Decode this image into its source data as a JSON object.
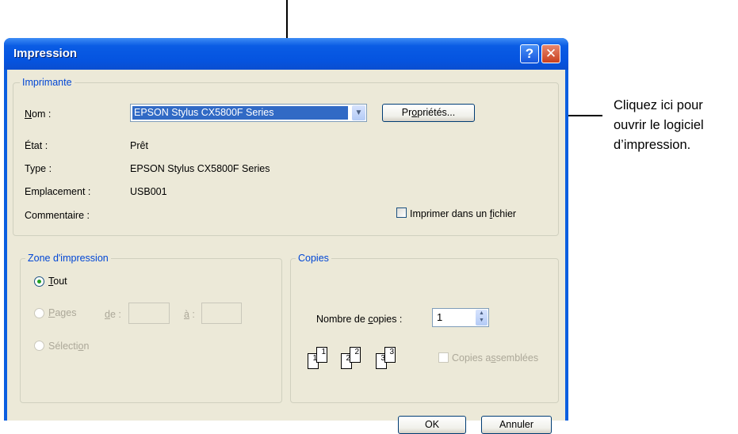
{
  "callout": {
    "line1": "Cliquez ici pour",
    "line2": "ouvrir le logiciel",
    "line3": "d’impression."
  },
  "dialog": {
    "title": "Impression",
    "help_glyph": "?",
    "close_glyph": "✕"
  },
  "printer": {
    "legend": "Imprimante",
    "name_label_u": "N",
    "name_label_rest": "om :",
    "name_value": "EPSON Stylus CX5800F Series",
    "properties_prefix": "Pr",
    "properties_u": "o",
    "properties_rest": "priétés...",
    "state_label": "État :",
    "state_value": "Prêt",
    "type_label": "Type :",
    "type_value": "EPSON Stylus CX5800F Series",
    "location_label": "Emplacement :",
    "location_value": "USB001",
    "comment_label": "Commentaire :",
    "print_to_file_prefix": "Imprimer dans un ",
    "print_to_file_u": "f",
    "print_to_file_rest": "ichier"
  },
  "range": {
    "legend": "Zone d'impression",
    "all_u": "T",
    "all_rest": "out",
    "pages_u": "P",
    "pages_rest": "ages",
    "from_u": "d",
    "from_rest": "e :",
    "to_u": "à",
    "to_rest": " :",
    "selection_prefix": "Sélecti",
    "selection_u": "o",
    "selection_rest": "n"
  },
  "copies": {
    "legend": "Copies",
    "count_label_prefix": "Nombre de ",
    "count_label_u": "c",
    "count_label_rest": "opies :",
    "count_value": "1",
    "collate_prefix": "Copies a",
    "collate_u": "s",
    "collate_rest": "semblées",
    "page_numbers": [
      "1",
      "1",
      "2",
      "2",
      "3",
      "3"
    ]
  },
  "buttons": {
    "ok": "OK",
    "cancel": "Annuler"
  }
}
